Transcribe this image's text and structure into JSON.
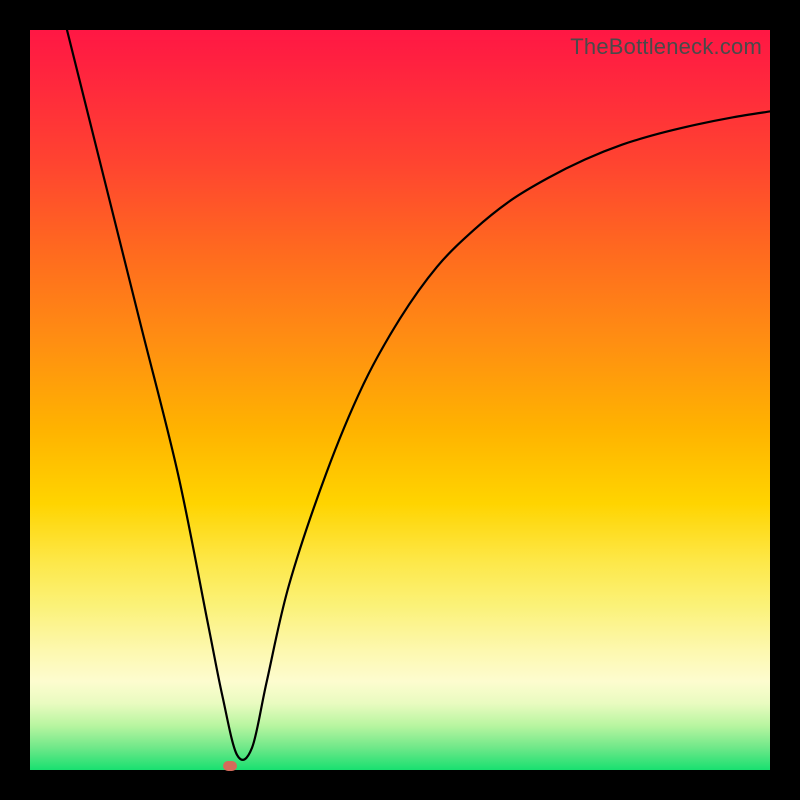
{
  "attribution": "TheBottleneck.com",
  "colors": {
    "frame": "#000000",
    "gradient_top": "#ff1744",
    "gradient_bottom": "#18e070",
    "curve": "#000000",
    "marker": "#d46a5a"
  },
  "chart_data": {
    "type": "line",
    "title": "",
    "xlabel": "",
    "ylabel": "",
    "xlim": [
      0,
      100
    ],
    "ylim": [
      0,
      100
    ],
    "grid": false,
    "legend": false,
    "series": [
      {
        "name": "bottleneck-curve",
        "x": [
          5,
          10,
          15,
          20,
          24,
          26,
          28,
          30,
          32,
          35,
          40,
          45,
          50,
          55,
          60,
          65,
          70,
          75,
          80,
          85,
          90,
          95,
          100
        ],
        "values": [
          100,
          80,
          60,
          40,
          20,
          10,
          2,
          3,
          12,
          25,
          40,
          52,
          61,
          68,
          73,
          77,
          80,
          82.5,
          84.5,
          86,
          87.2,
          88.2,
          89
        ]
      }
    ],
    "marker": {
      "x": 27,
      "y": 0.5
    }
  }
}
